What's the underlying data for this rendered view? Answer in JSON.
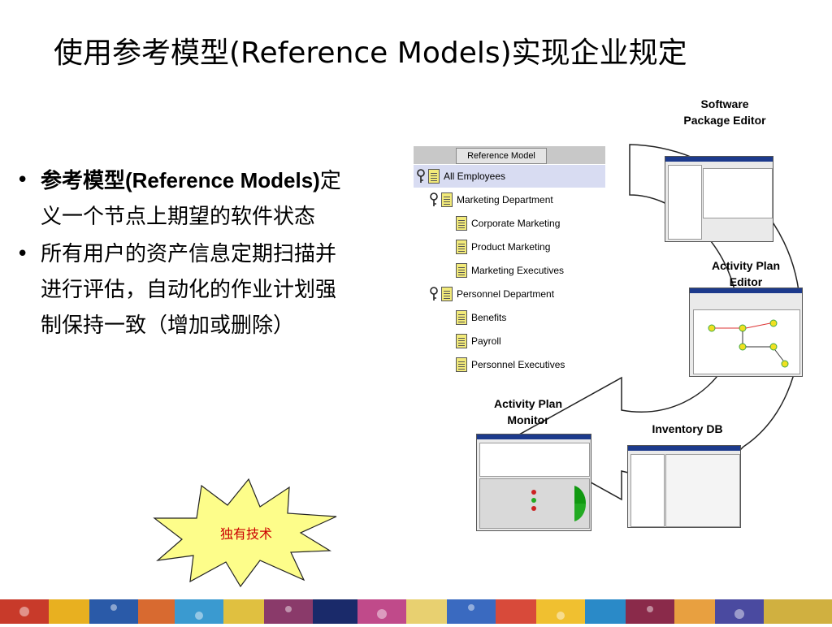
{
  "title": "使用参考模型(Reference Models)实现企业规定",
  "bullets": [
    {
      "marker": "•",
      "bold": "参考模型(Reference Models)",
      "text": "定义一个节点上期望的软件状态"
    },
    {
      "marker": "•",
      "bold": "",
      "text": "所有用户的资产信息定期扫描并进行评估，自动化的作业计划强制保持一致（增加或删除）"
    }
  ],
  "badge": {
    "label": "独有技术",
    "fill": "#fdfd8a",
    "text_color": "#cc0000"
  },
  "reference_tree": {
    "tab": "Reference Model",
    "rows": [
      {
        "label": "All Employees",
        "icon": "key-icon"
      },
      {
        "label": "Marketing Department",
        "icon": "key-icon"
      },
      {
        "label": "Corporate Marketing",
        "icon": "document-icon"
      },
      {
        "label": "Product Marketing",
        "icon": "document-icon"
      },
      {
        "label": "Marketing Executives",
        "icon": "document-icon"
      },
      {
        "label": "Personnel Department",
        "icon": "key-icon"
      },
      {
        "label": "Benefits",
        "icon": "document-icon"
      },
      {
        "label": "Payroll",
        "icon": "document-icon"
      },
      {
        "label": "Personnel Executives",
        "icon": "document-icon"
      }
    ]
  },
  "cycle": {
    "software_editor": "Software\nPackage Editor",
    "activity_editor": "Activity Plan\nEditor",
    "activity_monitor": "Activity Plan\nMonitor",
    "inventory_db": "Inventory DB"
  }
}
